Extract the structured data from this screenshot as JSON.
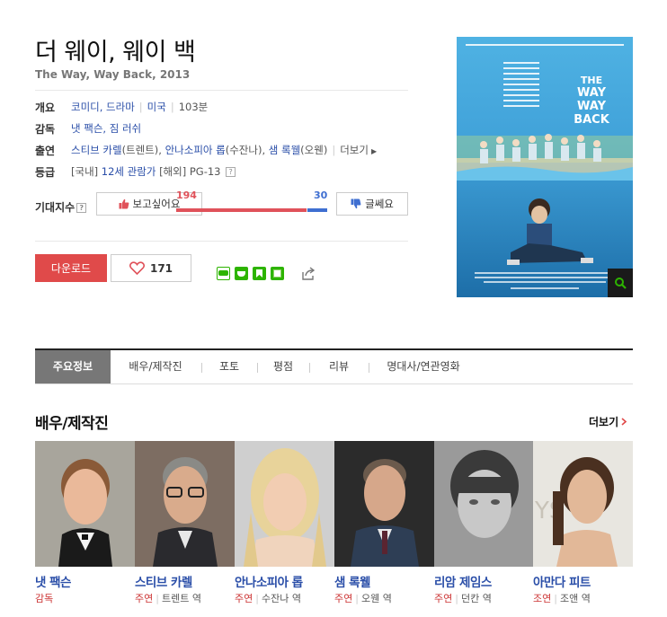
{
  "movie": {
    "title": "더 웨이, 웨이 백",
    "subtitle": "The Way, Way Back, 2013"
  },
  "info": {
    "overview_label": "개요",
    "genre": "코미디, 드라마",
    "country": "미국",
    "runtime": "103분",
    "director_label": "감독",
    "directors": "냇 팩슨, 짐 러쉬",
    "cast_label": "출연",
    "cast_1": "스티브 카렐",
    "cast_1_role": "(트렌트), ",
    "cast_2": "안나소피아 롭",
    "cast_2_role": "(수잔나), ",
    "cast_3": "샘 록웰",
    "cast_3_role": "(오웬)",
    "cast_more": "더보기",
    "rating_label": "등급",
    "rating_domestic_tag": "[국내]",
    "rating_domestic": "12세 관람가",
    "rating_foreign_tag": "[해외]",
    "rating_foreign": "PG-13"
  },
  "expectation": {
    "label": "기대지수",
    "want_label": "보고싶어요",
    "no_label": "글쎄요",
    "want_count": 194,
    "no_count": 30,
    "want_text": "194",
    "no_text": "30"
  },
  "actions": {
    "download": "다운로드",
    "like_count": "171"
  },
  "colors": {
    "accent_red": "#e04a4a",
    "link_blue": "#2a4ea8",
    "bar_blue": "#3f6fd1"
  },
  "tabs": [
    {
      "label": "주요정보",
      "active": true
    },
    {
      "label": "배우/제작진",
      "active": false
    },
    {
      "label": "포토",
      "active": false
    },
    {
      "label": "평점",
      "active": false
    },
    {
      "label": "리뷰",
      "active": false
    },
    {
      "label": "명대사/연관영화",
      "active": false
    }
  ],
  "cast_section": {
    "title": "배우/제작진",
    "more": "더보기",
    "people": [
      {
        "name": "냇 팩슨",
        "role": "감독",
        "character": ""
      },
      {
        "name": "스티브 카렐",
        "role": "주연",
        "character": "트렌트 역"
      },
      {
        "name": "안나소피아 롭",
        "role": "주연",
        "character": "수잔나 역"
      },
      {
        "name": "샘 록웰",
        "role": "주연",
        "character": "오웬 역"
      },
      {
        "name": "리암 제임스",
        "role": "주연",
        "character": "던칸 역"
      },
      {
        "name": "아만다 피트",
        "role": "조연",
        "character": "조앤 역"
      }
    ]
  }
}
